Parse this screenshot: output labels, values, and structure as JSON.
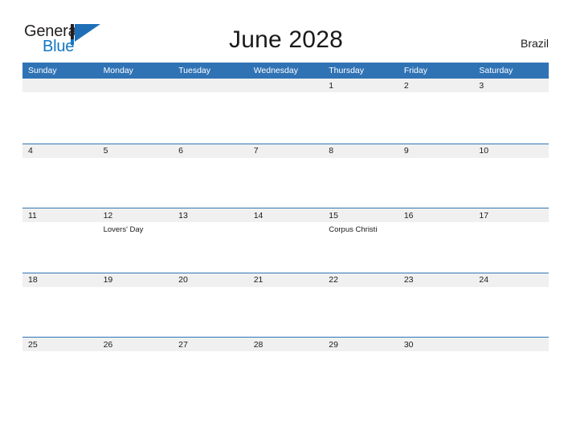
{
  "brand": {
    "name_part1": "General",
    "name_part2": "Blue",
    "mark": "triangle-flag-mark"
  },
  "header": {
    "title": "June 2028",
    "region": "Brazil"
  },
  "colors": {
    "header_blue": "#3073b5",
    "row_rule_blue": "#2e75b6",
    "day_band_gray": "#f0f0f0",
    "logo_blue": "#1277c4",
    "text_dark": "#1a1a1a"
  },
  "calendar": {
    "weekday_headers": [
      "Sunday",
      "Monday",
      "Tuesday",
      "Wednesday",
      "Thursday",
      "Friday",
      "Saturday"
    ],
    "weeks": [
      [
        {
          "day": "",
          "events": []
        },
        {
          "day": "",
          "events": []
        },
        {
          "day": "",
          "events": []
        },
        {
          "day": "",
          "events": []
        },
        {
          "day": "1",
          "events": []
        },
        {
          "day": "2",
          "events": []
        },
        {
          "day": "3",
          "events": []
        }
      ],
      [
        {
          "day": "4",
          "events": []
        },
        {
          "day": "5",
          "events": []
        },
        {
          "day": "6",
          "events": []
        },
        {
          "day": "7",
          "events": []
        },
        {
          "day": "8",
          "events": []
        },
        {
          "day": "9",
          "events": []
        },
        {
          "day": "10",
          "events": []
        }
      ],
      [
        {
          "day": "11",
          "events": []
        },
        {
          "day": "12",
          "events": [
            "Lovers' Day"
          ]
        },
        {
          "day": "13",
          "events": []
        },
        {
          "day": "14",
          "events": []
        },
        {
          "day": "15",
          "events": [
            "Corpus Christi"
          ]
        },
        {
          "day": "16",
          "events": []
        },
        {
          "day": "17",
          "events": []
        }
      ],
      [
        {
          "day": "18",
          "events": []
        },
        {
          "day": "19",
          "events": []
        },
        {
          "day": "20",
          "events": []
        },
        {
          "day": "21",
          "events": []
        },
        {
          "day": "22",
          "events": []
        },
        {
          "day": "23",
          "events": []
        },
        {
          "day": "24",
          "events": []
        }
      ],
      [
        {
          "day": "25",
          "events": []
        },
        {
          "day": "26",
          "events": []
        },
        {
          "day": "27",
          "events": []
        },
        {
          "day": "28",
          "events": []
        },
        {
          "day": "29",
          "events": []
        },
        {
          "day": "30",
          "events": []
        },
        {
          "day": "",
          "events": []
        }
      ]
    ]
  }
}
